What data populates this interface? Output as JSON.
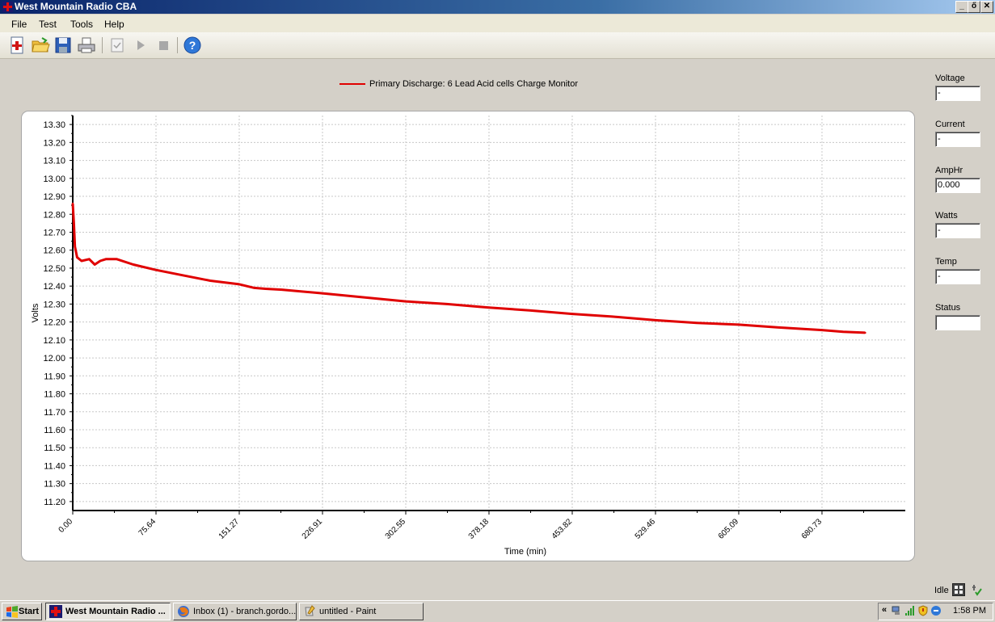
{
  "window": {
    "title": "West Mountain Radio CBA",
    "minimize": "_",
    "restore": "ő",
    "close": "✕"
  },
  "menu": [
    "File",
    "Test",
    "Tools",
    "Help"
  ],
  "toolbar": {
    "icons": [
      "new-test-icon",
      "open-folder-icon",
      "save-icon",
      "print-icon",
      "checklist-icon",
      "play-icon",
      "stop-icon",
      "help-icon"
    ]
  },
  "chart_data": {
    "type": "line",
    "legend": "Primary Discharge: 6 Lead Acid cells Charge Monitor",
    "xlabel": "Time (min)",
    "ylabel": "Volts",
    "xlim": [
      0,
      756.4
    ],
    "ylim": [
      11.15,
      13.35
    ],
    "x_ticks": [
      "0.00",
      "75.64",
      "151.27",
      "226.91",
      "302.55",
      "378.18",
      "453.82",
      "529.46",
      "605.09",
      "680.73"
    ],
    "y_ticks": [
      "13.30",
      "13.20",
      "13.10",
      "13.00",
      "12.90",
      "12.80",
      "12.70",
      "12.60",
      "12.50",
      "12.40",
      "12.30",
      "12.20",
      "12.10",
      "12.00",
      "11.90",
      "11.80",
      "11.70",
      "11.60",
      "11.50",
      "11.40",
      "11.30",
      "11.20"
    ],
    "grid": true,
    "series": [
      {
        "name": "Primary Discharge: 6 Lead Acid cells Charge Monitor",
        "color": "#e00000",
        "points": [
          [
            0,
            12.86
          ],
          [
            1,
            12.75
          ],
          [
            2,
            12.62
          ],
          [
            4,
            12.56
          ],
          [
            8,
            12.54
          ],
          [
            15,
            12.55
          ],
          [
            20,
            12.52
          ],
          [
            25,
            12.54
          ],
          [
            30,
            12.55
          ],
          [
            40,
            12.55
          ],
          [
            55,
            12.52
          ],
          [
            75.64,
            12.49
          ],
          [
            100,
            12.46
          ],
          [
            125,
            12.43
          ],
          [
            151.27,
            12.41
          ],
          [
            165,
            12.39
          ],
          [
            175,
            12.385
          ],
          [
            190,
            12.38
          ],
          [
            226.91,
            12.36
          ],
          [
            260,
            12.34
          ],
          [
            302.55,
            12.315
          ],
          [
            340,
            12.3
          ],
          [
            378.18,
            12.28
          ],
          [
            415,
            12.265
          ],
          [
            453.82,
            12.245
          ],
          [
            490,
            12.23
          ],
          [
            529.46,
            12.21
          ],
          [
            567,
            12.195
          ],
          [
            605.09,
            12.185
          ],
          [
            640,
            12.17
          ],
          [
            680.73,
            12.155
          ],
          [
            700,
            12.145
          ],
          [
            720,
            12.14
          ]
        ]
      }
    ]
  },
  "readouts": [
    {
      "label": "Voltage",
      "value": "-"
    },
    {
      "label": "Current",
      "value": "-"
    },
    {
      "label": "AmpHr",
      "value": "0.000"
    },
    {
      "label": "Watts",
      "value": "-"
    },
    {
      "label": "Temp",
      "value": "-"
    },
    {
      "label": "Status",
      "value": ""
    }
  ],
  "status": {
    "state": "Idle"
  },
  "taskbar": {
    "start": "Start",
    "tasks": [
      {
        "label": "West Mountain Radio ...",
        "active": true
      },
      {
        "label": "Inbox (1) - branch.gordo...",
        "active": false
      },
      {
        "label": "untitled - Paint",
        "active": false
      }
    ],
    "tray_chevron": "«",
    "clock": "1:58 PM"
  }
}
